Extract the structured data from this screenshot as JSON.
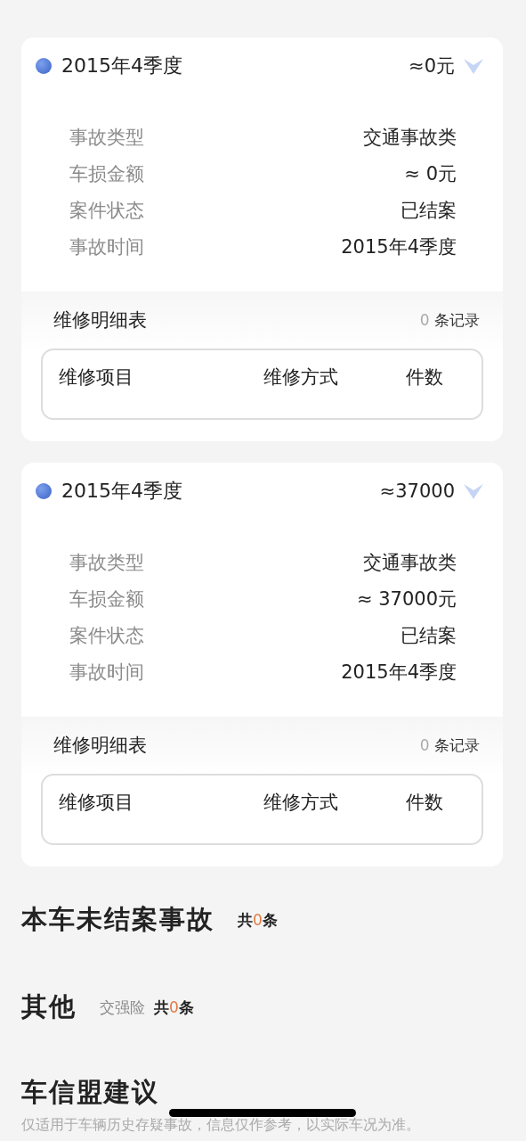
{
  "accidents": [
    {
      "period": "2015年4季度",
      "amount": "≈0元",
      "details": [
        {
          "label": "事故类型",
          "value": "交通事故类"
        },
        {
          "label": "车损金额",
          "value": "≈ 0元"
        },
        {
          "label": "案件状态",
          "value": "已结案"
        },
        {
          "label": "事故时间",
          "value": "2015年4季度"
        }
      ],
      "repair": {
        "title": "维修明细表",
        "count": "0",
        "count_unit": "条记录",
        "columns": [
          "维修项目",
          "维修方式",
          "件数"
        ]
      }
    },
    {
      "period": "2015年4季度",
      "amount": "≈37000",
      "details": [
        {
          "label": "事故类型",
          "value": "交通事故类"
        },
        {
          "label": "车损金额",
          "value": "≈ 37000元"
        },
        {
          "label": "案件状态",
          "value": "已结案"
        },
        {
          "label": "事故时间",
          "value": "2015年4季度"
        }
      ],
      "repair": {
        "title": "维修明细表",
        "count": "0",
        "count_unit": "条记录",
        "columns": [
          "维修项目",
          "维修方式",
          "件数"
        ]
      }
    }
  ],
  "sections": [
    {
      "title": "本车未结案事故",
      "prefix": "共",
      "count": "0",
      "suffix": "条"
    },
    {
      "title": "其他",
      "tag": "交强险",
      "prefix": "共",
      "count": "0",
      "suffix": "条"
    }
  ],
  "advice": {
    "title": "车信盟建议",
    "text": "仅适用于车辆历史存疑事故，信息仅作参考，以实际车况为准。"
  }
}
